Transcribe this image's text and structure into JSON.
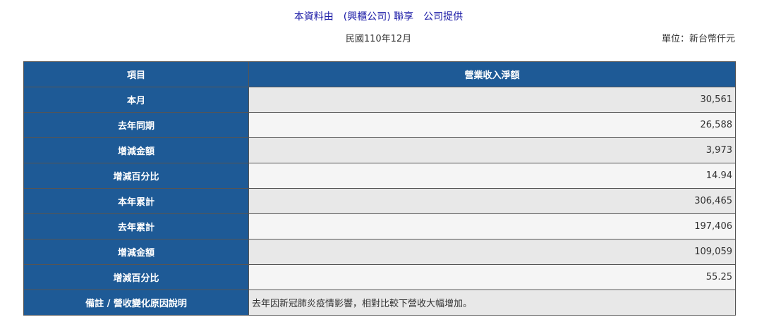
{
  "header": {
    "title": "本資料由　(興櫃公司) 聯享　公司提供",
    "period": "民國110年12月",
    "unit": "單位：新台幣仟元"
  },
  "table": {
    "col_item": "項目",
    "col_revenue": "營業收入淨額",
    "rows": [
      {
        "label": "本月",
        "value": "30,561"
      },
      {
        "label": "去年同期",
        "value": "26,588"
      },
      {
        "label": "增減金額",
        "value": "3,973"
      },
      {
        "label": "增減百分比",
        "value": "14.94"
      },
      {
        "label": "本年累計",
        "value": "306,465"
      },
      {
        "label": "去年累計",
        "value": "197,406"
      },
      {
        "label": "增減金額",
        "value": "109,059"
      },
      {
        "label": "增減百分比",
        "value": "55.25"
      }
    ],
    "note_label": "備註 / 營收變化原因說明",
    "note_value": "去年因新冠肺炎疫情影響，相對比較下營收大幅增加。"
  },
  "colors": {
    "header_bg": "#1e5a96",
    "title_text": "#1a1aa6"
  }
}
